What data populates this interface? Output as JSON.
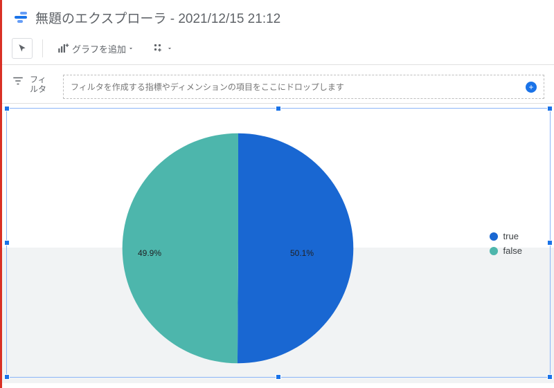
{
  "header": {
    "title": "無題のエクスプローラ - 2021/12/15 21:12"
  },
  "toolbar": {
    "add_chart_label": "グラフを追加"
  },
  "filter": {
    "label": "フィルタ",
    "placeholder": "フィルタを作成する指標やディメンションの項目をここにドロップします"
  },
  "legend": {
    "true_label": "true",
    "false_label": "false"
  },
  "slice_labels": {
    "true": "50.1%",
    "false": "49.9%"
  },
  "colors": {
    "true": "#1967d2",
    "false": "#4db6ac"
  },
  "chart_data": {
    "type": "pie",
    "title": "",
    "series": [
      {
        "name": "true",
        "value": 50.1,
        "color": "#1967d2"
      },
      {
        "name": "false",
        "value": 49.9,
        "color": "#4db6ac"
      }
    ],
    "value_format": "percent",
    "legend_position": "right"
  }
}
